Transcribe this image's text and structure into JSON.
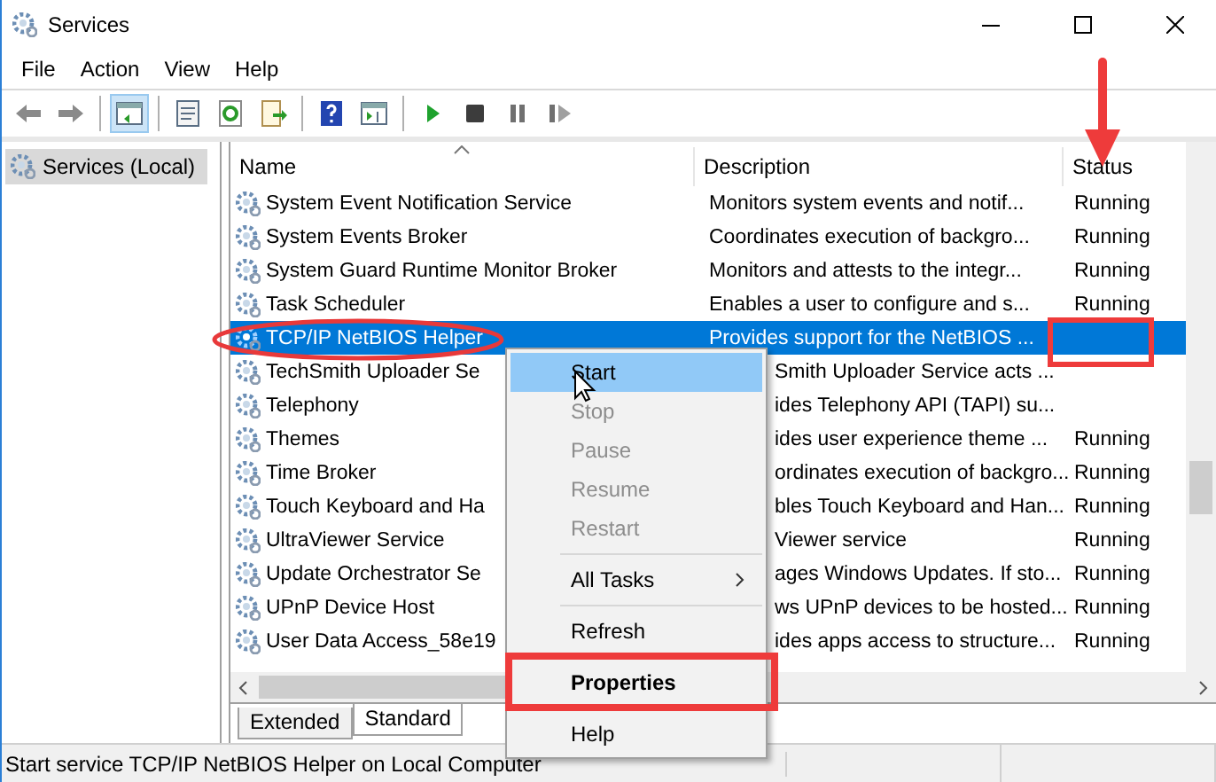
{
  "window": {
    "title": "Services"
  },
  "menu_bar": [
    "File",
    "Action",
    "View",
    "Help"
  ],
  "toolbar": [
    {
      "kind": "back",
      "pressed": false
    },
    {
      "kind": "forward",
      "pressed": false
    },
    {
      "kind": "sep"
    },
    {
      "kind": "tree",
      "pressed": true
    },
    {
      "kind": "sep"
    },
    {
      "kind": "props",
      "pressed": false
    },
    {
      "kind": "refresh",
      "pressed": false
    },
    {
      "kind": "export",
      "pressed": false
    },
    {
      "kind": "sep"
    },
    {
      "kind": "help",
      "pressed": false
    },
    {
      "kind": "pane",
      "pressed": false
    },
    {
      "kind": "sep"
    },
    {
      "kind": "play",
      "pressed": false
    },
    {
      "kind": "stop",
      "pressed": false
    },
    {
      "kind": "pause",
      "pressed": false
    },
    {
      "kind": "resume",
      "pressed": false
    }
  ],
  "tree": [
    {
      "label": "Services (Local)",
      "selected": true
    }
  ],
  "table": {
    "columns": [
      "Name",
      "Description",
      "Status"
    ],
    "rows": [
      {
        "name": "System Event Notification Service",
        "description": "Monitors system events and notif...",
        "status": "Running",
        "selected": false
      },
      {
        "name": "System Events Broker",
        "description": "Coordinates execution of backgro...",
        "status": "Running",
        "selected": false
      },
      {
        "name": "System Guard Runtime Monitor Broker",
        "description": "Monitors and attests to the integr...",
        "status": "Running",
        "selected": false
      },
      {
        "name": "Task Scheduler",
        "description": "Enables a user to configure and s...",
        "status": "Running",
        "selected": false
      },
      {
        "name": "TCP/IP NetBIOS Helper",
        "description": "Provides support for the NetBIOS ...",
        "selected": true
      },
      {
        "name": "TechSmith Uploader Se",
        "description": "Smith Uploader Service acts ...",
        "selected": false
      },
      {
        "name": "Telephony",
        "description": "ides Telephony API (TAPI) su...",
        "selected": false
      },
      {
        "name": "Themes",
        "description": "ides user experience theme ...",
        "status": "Running",
        "selected": false
      },
      {
        "name": "Time Broker",
        "description": "ordinates execution of backgro...",
        "status": "Running",
        "selected": false
      },
      {
        "name": "Touch Keyboard and Ha",
        "description": "bles Touch Keyboard and Han...",
        "status": "Running",
        "selected": false
      },
      {
        "name": "UltraViewer Service",
        "description": "Viewer service",
        "status": "Running",
        "selected": false
      },
      {
        "name": "Update Orchestrator Se",
        "description": "ages Windows Updates. If sto...",
        "status": "Running",
        "selected": false
      },
      {
        "name": "UPnP Device Host",
        "description": "ws UPnP devices to be hosted...",
        "status": "Running",
        "selected": false
      },
      {
        "name": "User Data Access_58e19",
        "description": "ides apps access to structure...",
        "status": "Running",
        "selected": false
      }
    ]
  },
  "context_menu": [
    {
      "kind": "item",
      "label": "Start",
      "disabled": false,
      "hovered": true
    },
    {
      "kind": "item",
      "label": "Stop",
      "disabled": true,
      "hovered": false
    },
    {
      "kind": "item",
      "label": "Pause",
      "disabled": true,
      "hovered": false
    },
    {
      "kind": "item",
      "label": "Resume",
      "disabled": true,
      "hovered": false
    },
    {
      "kind": "item",
      "label": "Restart",
      "disabled": true,
      "hovered": false
    },
    {
      "kind": "separator"
    },
    {
      "kind": "item",
      "label": "All Tasks",
      "disabled": false,
      "hovered": false,
      "submenu": true
    },
    {
      "kind": "separator"
    },
    {
      "kind": "item",
      "label": "Refresh",
      "disabled": false,
      "hovered": false
    },
    {
      "kind": "separator"
    },
    {
      "kind": "item",
      "label": "Properties",
      "disabled": false,
      "hovered": false,
      "default": true
    },
    {
      "kind": "separator"
    },
    {
      "kind": "item",
      "label": "Help",
      "disabled": false,
      "hovered": false
    }
  ],
  "view_tabs": [
    {
      "label": "Extended",
      "selected": false
    },
    {
      "label": "Standard",
      "selected": true
    }
  ],
  "status_bar": "Start service TCP/IP NetBIOS Helper on Local Computer"
}
